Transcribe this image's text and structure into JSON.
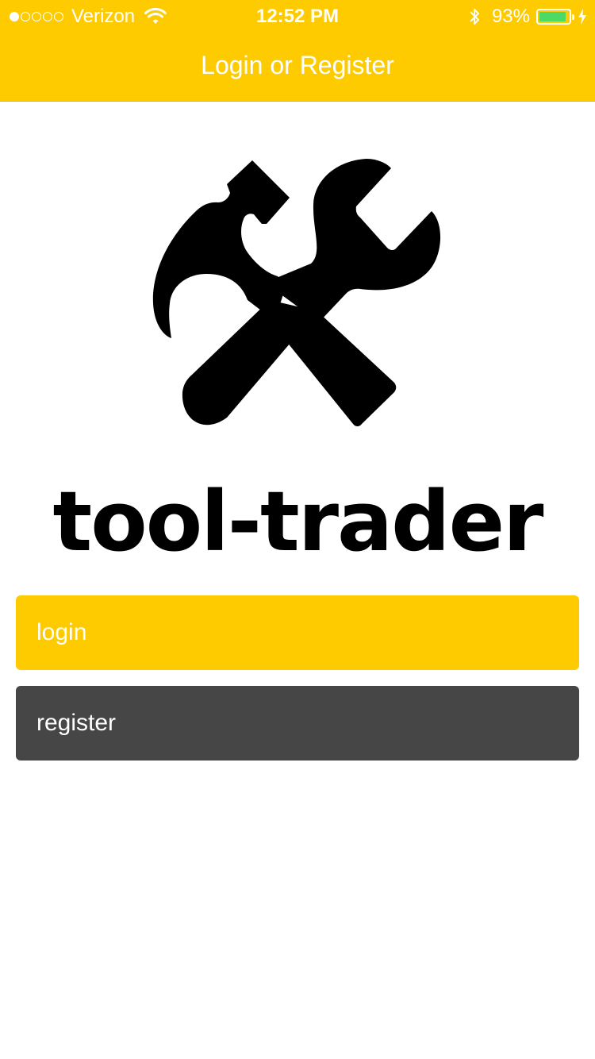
{
  "status_bar": {
    "carrier": "Verizon",
    "time": "12:52 PM",
    "battery_percent": "93%",
    "signal_bars": 1,
    "signal_max": 5,
    "battery_level": 0.93,
    "battery_fill_color": "#4CD964",
    "icons": [
      "wifi-icon",
      "bluetooth-icon",
      "battery-icon",
      "charging-bolt-icon"
    ]
  },
  "nav": {
    "title": "Login or Register",
    "background_color": "#FECB00"
  },
  "logo": {
    "icon": "hammer-wrench-icon",
    "name": "tool-trader"
  },
  "buttons": {
    "login_label": "login",
    "login_color": "#FECB00",
    "register_label": "register",
    "register_color": "#464646"
  }
}
